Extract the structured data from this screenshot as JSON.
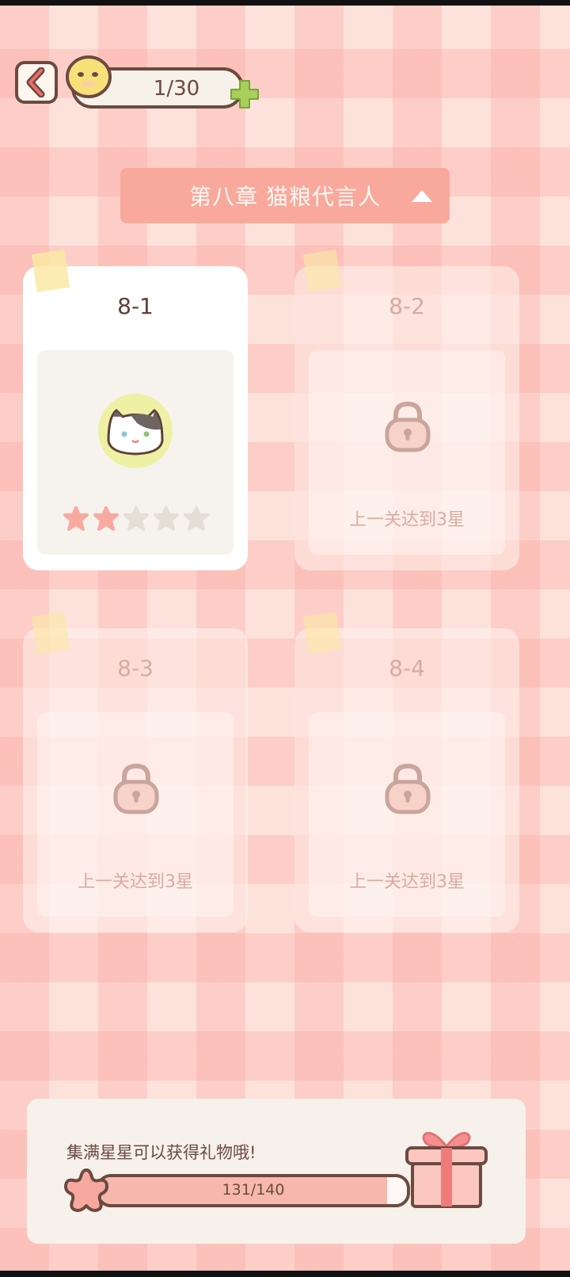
{
  "header": {
    "energy_count": "1/30"
  },
  "chapter": {
    "title": "第八章  猫粮代言人"
  },
  "levels": [
    {
      "id": "8-1",
      "status": "unlocked",
      "stars_earned": 2,
      "stars_total": 5
    },
    {
      "id": "8-2",
      "status": "locked",
      "hint": "上一关达到3星"
    },
    {
      "id": "8-3",
      "status": "locked",
      "hint": "上一关达到3星"
    },
    {
      "id": "8-4",
      "status": "locked",
      "hint": "上一关达到3星"
    }
  ],
  "gift": {
    "message": "集满星星可以获得礼物哦!",
    "progress_text": "131/140",
    "progress_value": 131,
    "progress_max": 140
  },
  "colors": {
    "accent": "#f8a99b",
    "outline": "#6b4a40",
    "star_earned": "#f8aaa1",
    "star_empty": "#e4ded6"
  },
  "icons": {
    "back": "chevron-left-icon",
    "energy": "smiley-coin-icon",
    "add": "plus-icon",
    "caret": "caret-up-icon",
    "lock": "lock-icon",
    "star": "star-icon",
    "gift": "gift-box-icon",
    "cat": "cat-avatar-icon"
  }
}
